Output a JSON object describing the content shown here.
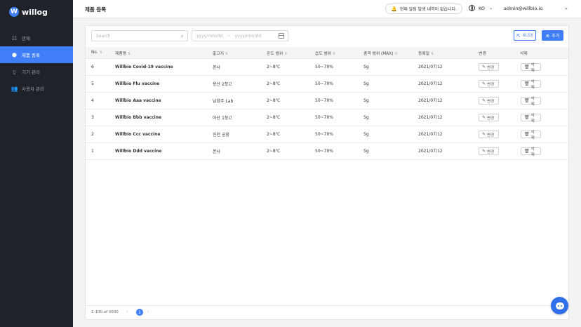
{
  "app": {
    "logo_letter": "W",
    "name": "willog"
  },
  "sidebar": {
    "items": [
      {
        "label": "관제",
        "icon": "list-icon",
        "active": false
      },
      {
        "label": "제품 등록",
        "icon": "cube-icon",
        "active": true
      },
      {
        "label": "기기 관리",
        "icon": "device-icon",
        "active": false
      },
      {
        "label": "사용자 관리",
        "icon": "users-icon",
        "active": false
      }
    ]
  },
  "header": {
    "title": "제품 등록",
    "alert_text": "현재 알림 발생 내역이 없습니다.",
    "language": "KO",
    "user_email": "admin@willbio.io"
  },
  "toolbar": {
    "search_placeholder": "Search",
    "date_start_placeholder": "yyyy/mm/dd",
    "date_separator": "~",
    "date_end_placeholder": "yyyy/mm/dd",
    "xlsx_label": "XLSX",
    "add_label": "추가"
  },
  "table": {
    "columns": [
      "No.",
      "제품명",
      "출고지",
      "온도 범위",
      "습도 범위",
      "충격 범위 (MAX)",
      "등록일",
      "변경",
      "삭제"
    ],
    "edit_label": "변경",
    "delete_label": "삭제",
    "rows": [
      {
        "no": "6",
        "name": "Willbio Covid-19 vaccine",
        "origin": "본사",
        "temp": "2~8℃",
        "humidity": "50~70%",
        "shock": "5g",
        "date": "2021/07/12"
      },
      {
        "no": "5",
        "name": "Willbio Flu vaccine",
        "origin": "용산 2창고",
        "temp": "2~8℃",
        "humidity": "50~70%",
        "shock": "5g",
        "date": "2021/07/12"
      },
      {
        "no": "4",
        "name": "Willbio Aaa vaccine",
        "origin": "남양주 Lab",
        "temp": "2~8℃",
        "humidity": "50~70%",
        "shock": "5g",
        "date": "2021/07/12"
      },
      {
        "no": "3",
        "name": "Willbio Bbb vaccine",
        "origin": "아산 1창고",
        "temp": "2~8℃",
        "humidity": "50~70%",
        "shock": "5g",
        "date": "2021/07/12"
      },
      {
        "no": "2",
        "name": "Willbio Ccc vaccine",
        "origin": "진천 공장",
        "temp": "2~8℃",
        "humidity": "50~70%",
        "shock": "5g",
        "date": "2021/07/12"
      },
      {
        "no": "1",
        "name": "Willbio Ddd vaccine",
        "origin": "본사",
        "temp": "2~8℃",
        "humidity": "50~70%",
        "shock": "5g",
        "date": "2021/07/12"
      }
    ]
  },
  "footer": {
    "count_text": "1-100 of 0000",
    "current_page": "1"
  },
  "colors": {
    "accent": "#3f7ef6",
    "sidebar_bg": "#1f2329"
  }
}
